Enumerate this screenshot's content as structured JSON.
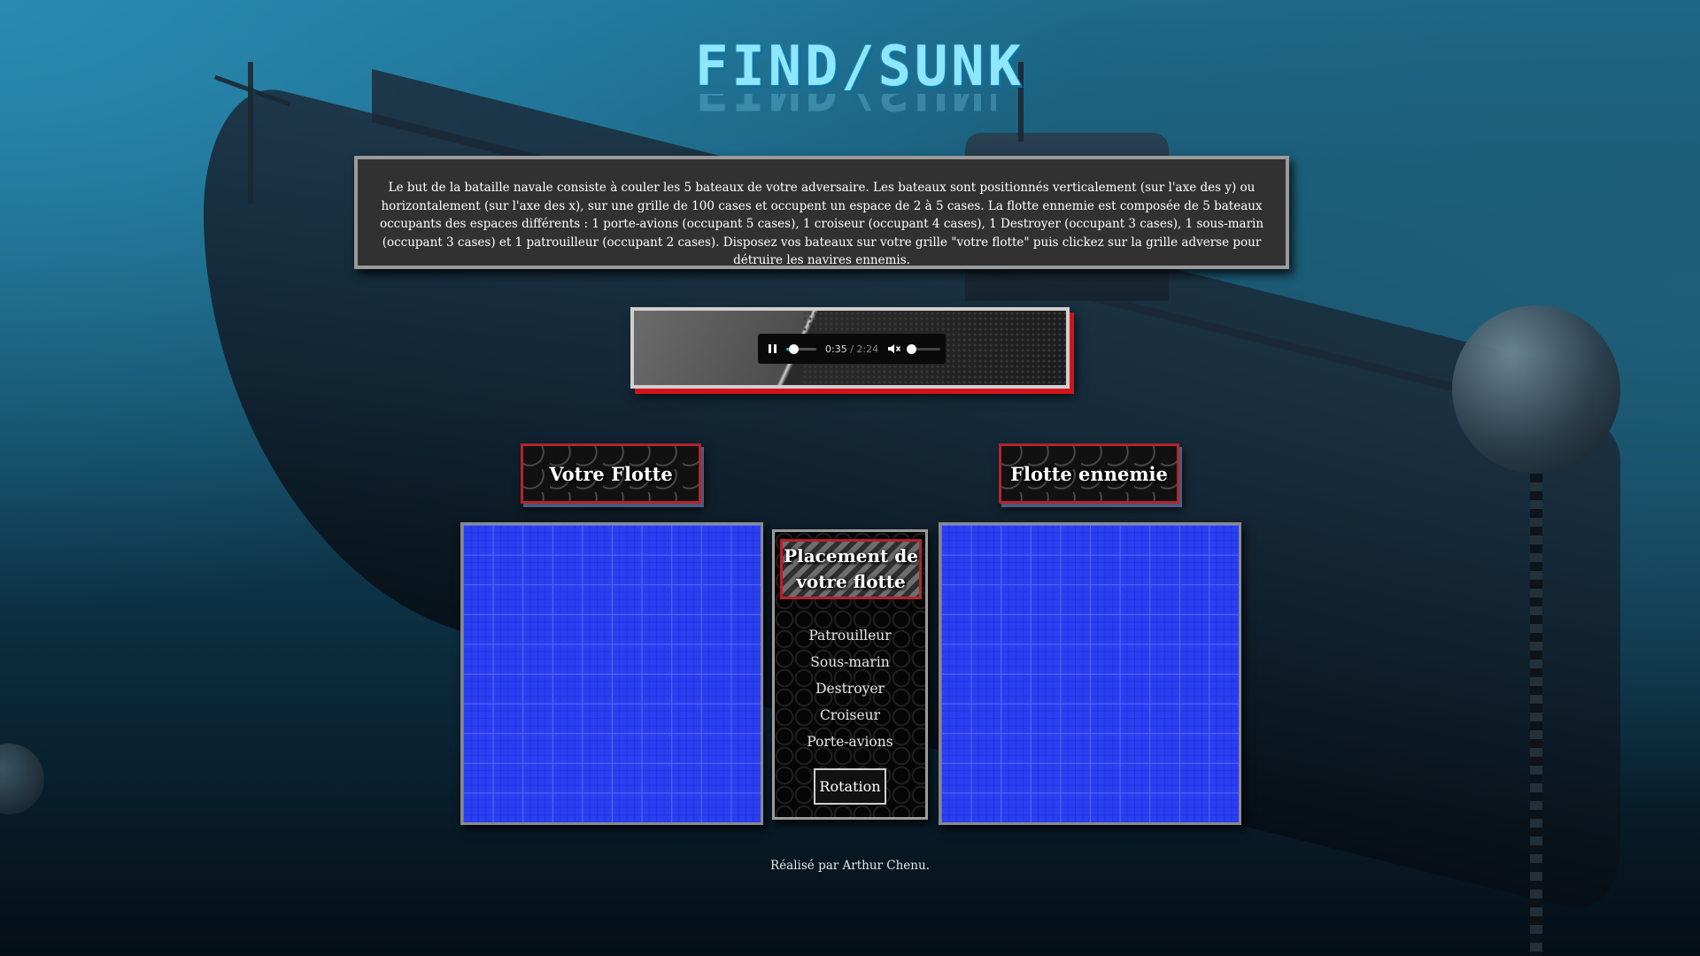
{
  "app": {
    "logo_text": "FIND/SUNK"
  },
  "rules": {
    "text": "Le but de la bataille navale consiste à couler les 5 bateaux de votre adversaire. Les bateaux sont positionnés verticalement (sur l'axe des y) ou horizontalement (sur l'axe des x), sur une grille de 100 cases et occupent un espace de 2 à 5 cases. La flotte ennemie est composée de 5 bateaux occupants des espaces différents : 1 porte-avions (occupant 5 cases), 1 croiseur (occupant 4 cases), 1 Destroyer (occupant 3 cases), 1 sous-marin (occupant 3 cases) et 1 patrouilleur (occupant 2 cases). Disposez vos bateaux sur votre grille \"votre flotte\" puis clickez sur la grille adverse pour détruire les navires ennemis."
  },
  "audio": {
    "current_time": "0:35",
    "separator": " / ",
    "duration": "2:24",
    "progress": 0.24,
    "volume": 0.0,
    "state": "playing",
    "accent_color": "#29aee0"
  },
  "fleets": {
    "player_title": "Votre Flotte",
    "enemy_title": "Flotte ennemie"
  },
  "placement": {
    "title": "Placement de votre flotte",
    "ships": [
      {
        "label": "Patrouilleur"
      },
      {
        "label": "Sous-marin"
      },
      {
        "label": "Destroyer"
      },
      {
        "label": "Croiseur"
      },
      {
        "label": "Porte-avions"
      }
    ],
    "rotation_label": "Rotation"
  },
  "footer": {
    "credit": "Réalisé par Arthur Chenu."
  },
  "colors": {
    "grid_water": "#2a3ff0",
    "frame_red": "#b5232a",
    "panel_gray": "#313131"
  },
  "icons": {
    "pause": "pause-icon",
    "mute": "volume-muted-icon"
  }
}
